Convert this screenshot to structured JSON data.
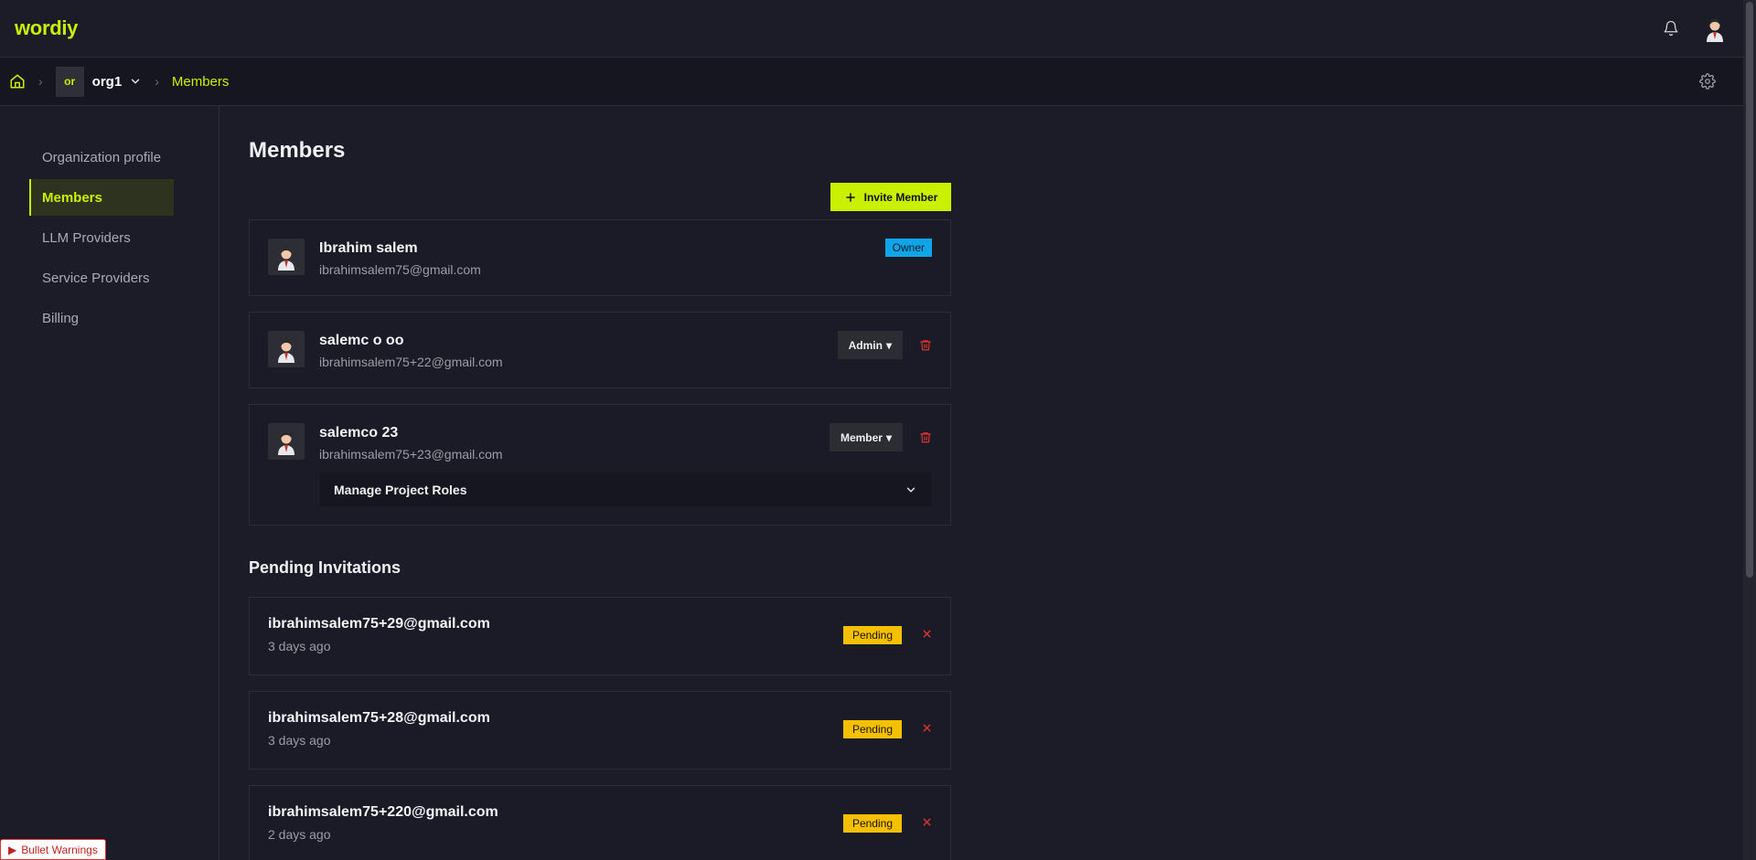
{
  "app": {
    "logo": "wordiy"
  },
  "breadcrumb": {
    "org_badge": "or",
    "org_name": "org1",
    "current": "Members"
  },
  "sidebar": {
    "items": [
      {
        "label": "Organization profile"
      },
      {
        "label": "Members"
      },
      {
        "label": "LLM Providers"
      },
      {
        "label": "Service Providers"
      },
      {
        "label": "Billing"
      }
    ]
  },
  "main": {
    "title": "Members",
    "invite_button": "Invite Member",
    "members": [
      {
        "name": "Ibrahim salem",
        "email": "ibrahimsalem75@gmail.com",
        "badge": "Owner"
      },
      {
        "name": "salemc o oo",
        "email": "ibrahimsalem75+22@gmail.com",
        "role": "Admin"
      },
      {
        "name": "salemco 23",
        "email": "ibrahimsalem75+23@gmail.com",
        "role": "Member",
        "manage_roles_label": "Manage Project Roles"
      }
    ],
    "pending_title": "Pending Invitations",
    "invitations": [
      {
        "email": "ibrahimsalem75+29@gmail.com",
        "time": "3 days ago",
        "status": "Pending"
      },
      {
        "email": "ibrahimsalem75+28@gmail.com",
        "time": "3 days ago",
        "status": "Pending"
      },
      {
        "email": "ibrahimsalem75+220@gmail.com",
        "time": "2 days ago",
        "status": "Pending"
      }
    ]
  },
  "footer": {
    "warnings_label": "Bullet Warnings"
  },
  "colors": {
    "accent": "#c8f000",
    "background": "#1b1c28",
    "owner_badge": "#0ea5e9",
    "pending_badge": "#f5c000",
    "danger": "#e0342f"
  },
  "icons": {
    "home": "home-icon",
    "bell": "bell-icon",
    "settings": "gear-icon",
    "trash": "trash-icon",
    "close": "close-icon",
    "plus": "plus-icon"
  }
}
